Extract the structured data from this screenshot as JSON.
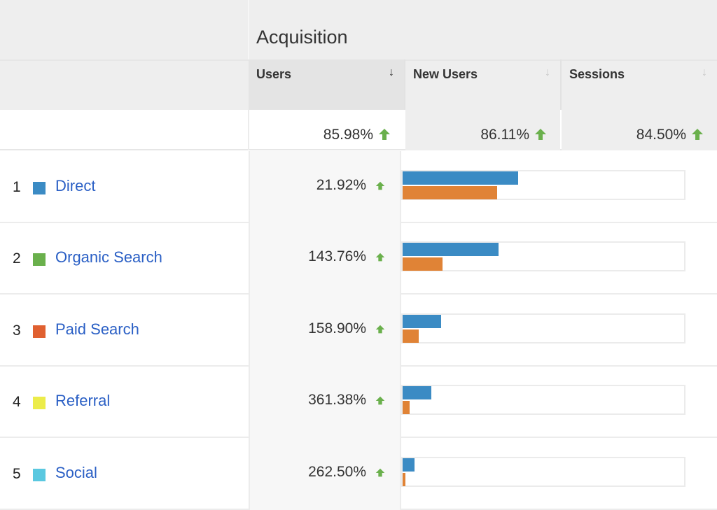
{
  "group_header": {
    "title": "Acquisition"
  },
  "columns": [
    {
      "label": "Users",
      "sorted": true,
      "sort_icon": "arrow-down-icon"
    },
    {
      "label": "New Users",
      "sorted": false,
      "sort_icon": "arrow-down-icon"
    },
    {
      "label": "Sessions",
      "sorted": false,
      "sort_icon": "arrow-down-icon"
    }
  ],
  "summary": {
    "users": "85.98%",
    "new_users": "86.11%",
    "sessions": "84.50%",
    "trend_icon": "up-arrow-icon"
  },
  "colors": {
    "link": "#2a5fc5",
    "trend_up": "#6ab04c",
    "bar_users": "#3b8bc4",
    "bar_new_users": "#e08336"
  },
  "rows": [
    {
      "rank": "1",
      "label": "Direct",
      "swatch": "#3b8bc4",
      "users_change": "21.92%",
      "bar_users_fraction": 0.41,
      "bar_new_users_fraction": 0.335
    },
    {
      "rank": "2",
      "label": "Organic Search",
      "swatch": "#6ab04c",
      "users_change": "143.76%",
      "bar_users_fraction": 0.34,
      "bar_new_users_fraction": 0.143
    },
    {
      "rank": "3",
      "label": "Paid Search",
      "swatch": "#e06030",
      "users_change": "158.90%",
      "bar_users_fraction": 0.138,
      "bar_new_users_fraction": 0.057
    },
    {
      "rank": "4",
      "label": "Referral",
      "swatch": "#ecec4a",
      "users_change": "361.38%",
      "bar_users_fraction": 0.101,
      "bar_new_users_fraction": 0.025
    },
    {
      "rank": "5",
      "label": "Social",
      "swatch": "#5ac8e0",
      "users_change": "262.50%",
      "bar_users_fraction": 0.042,
      "bar_new_users_fraction": 0.01
    }
  ]
}
